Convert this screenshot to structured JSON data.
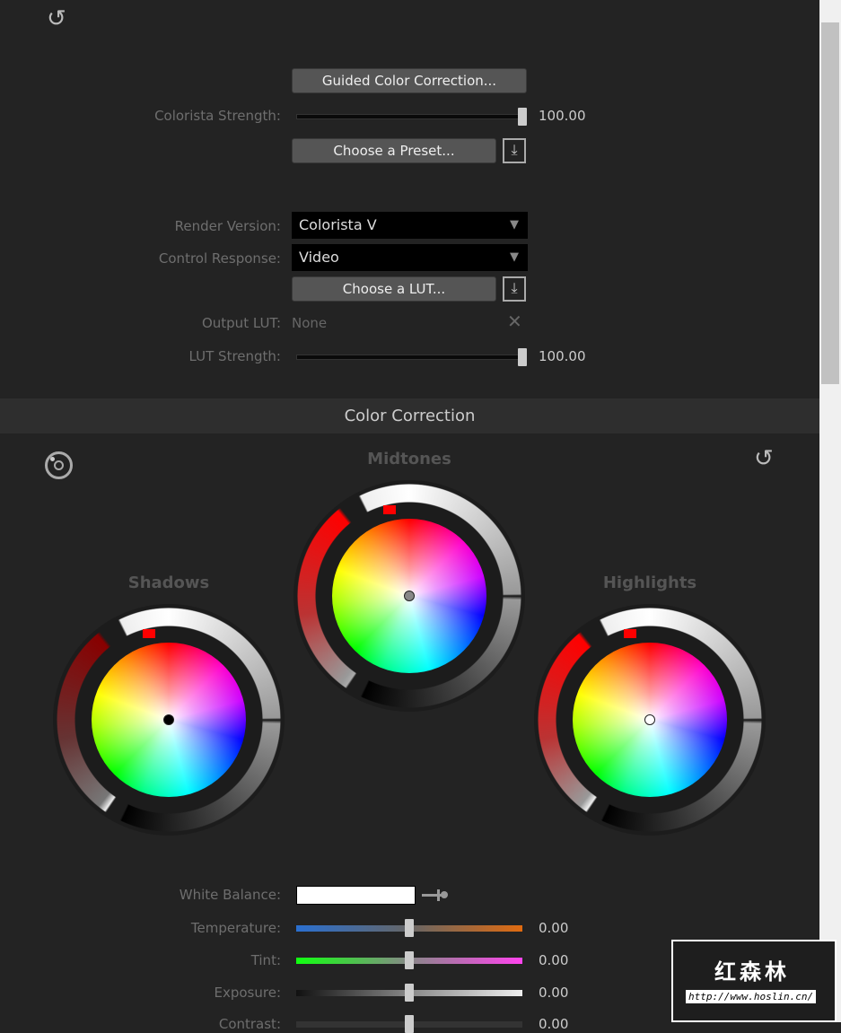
{
  "top": {
    "guided_button": "Guided Color Correction...",
    "strength_label": "Colorista Strength:",
    "strength_value": "100.00",
    "strength_fraction": 1.0,
    "preset_button": "Choose a Preset...",
    "render_label": "Render Version:",
    "render_value": "Colorista V",
    "response_label": "Control Response:",
    "response_value": "Video",
    "lut_button": "Choose a LUT...",
    "output_lut_label": "Output LUT:",
    "output_lut_value": "None",
    "lut_strength_label": "LUT Strength:",
    "lut_strength_value": "100.00",
    "lut_strength_fraction": 1.0
  },
  "section": {
    "title": "Color Correction"
  },
  "wheels": {
    "shadows": "Shadows",
    "midtones": "Midtones",
    "highlights": "Highlights"
  },
  "adjust": {
    "white_balance_label": "White Balance:",
    "white_balance_color": "#ffffff",
    "rows": [
      {
        "label": "Temperature:",
        "value": "0.00"
      },
      {
        "label": "Tint:",
        "value": "0.00"
      },
      {
        "label": "Exposure:",
        "value": "0.00"
      },
      {
        "label": "Contrast:",
        "value": "0.00"
      }
    ]
  },
  "watermark": {
    "text": "红森林",
    "url": "http://www.hoslin.cn/"
  },
  "icons": [
    "reset-icon",
    "target-icon",
    "download-icon",
    "close-icon",
    "eyedropper-icon",
    "dropdown-arrow-icon"
  ]
}
